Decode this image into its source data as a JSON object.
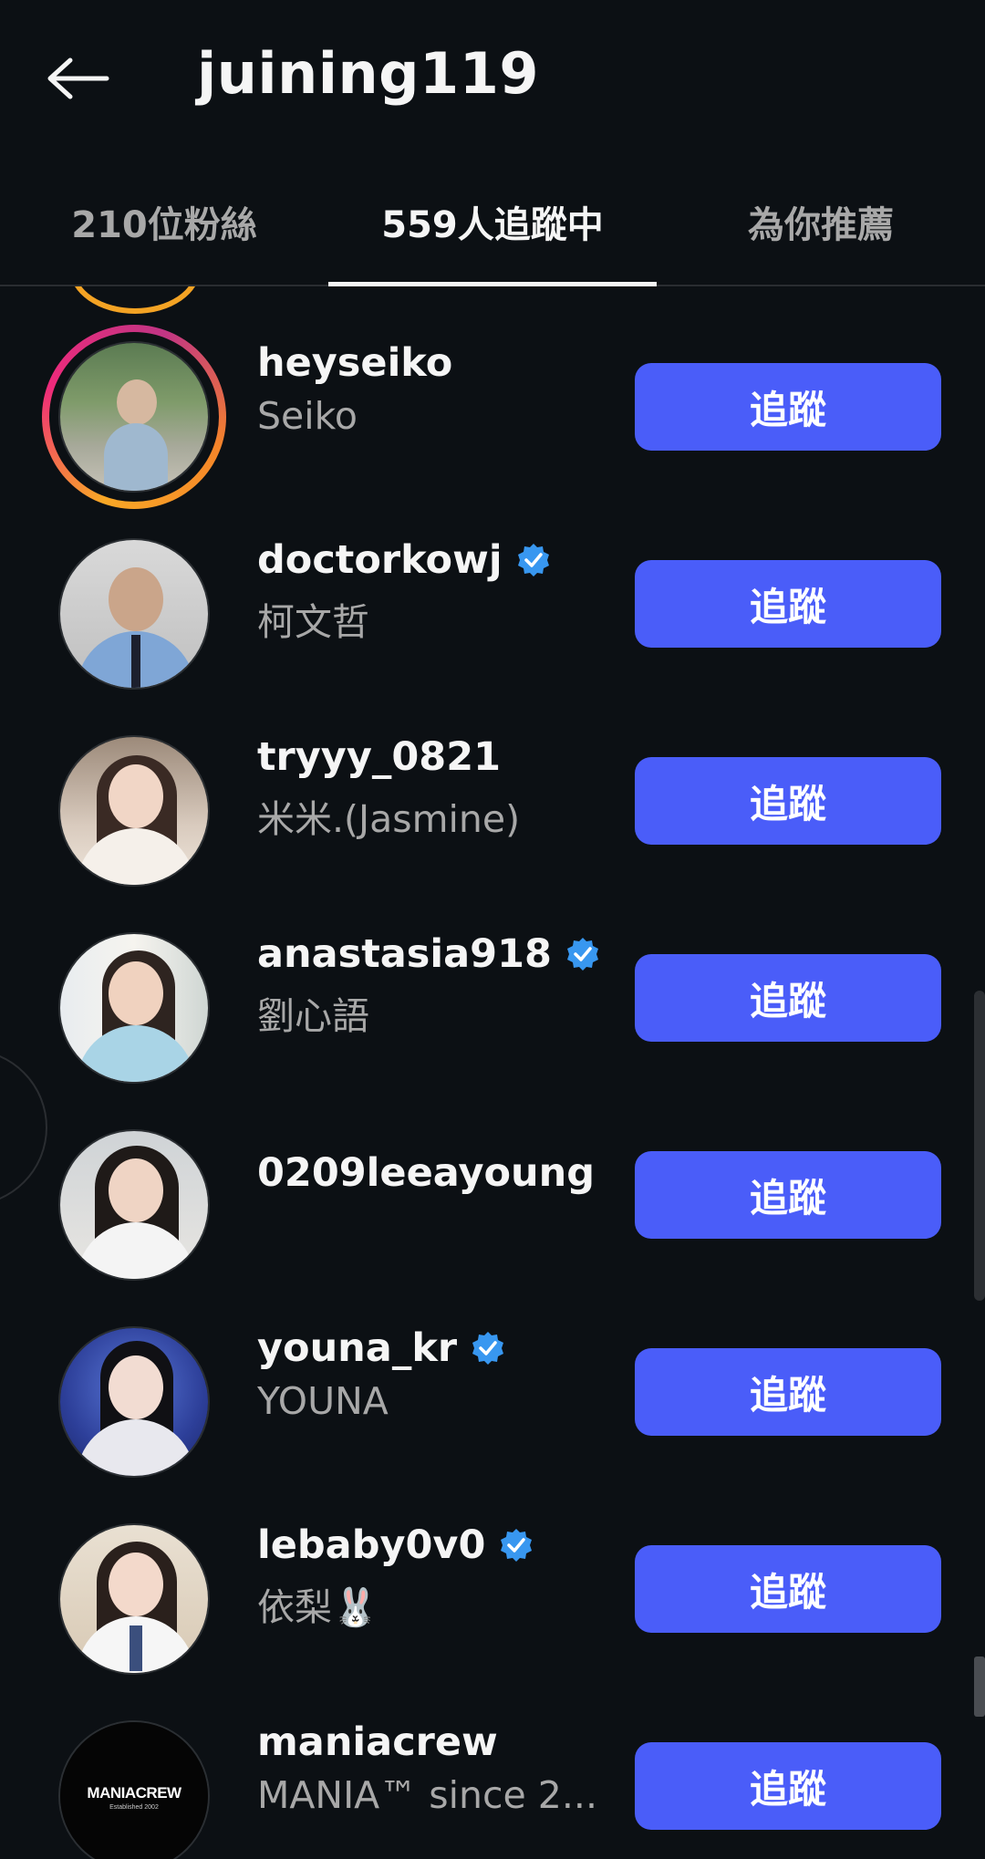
{
  "header": {
    "title": "juining119",
    "back_icon": "arrow-left-icon"
  },
  "tabs": [
    {
      "label": "210位粉絲",
      "active": false
    },
    {
      "label": "559人追蹤中",
      "active": true
    },
    {
      "label": "為你推薦",
      "active": false
    }
  ],
  "follow_label": "追蹤",
  "colors": {
    "background": "#0c1014",
    "button": "#4a5df9",
    "verified": "#3897f0",
    "secondary_text": "#a8a8a8"
  },
  "users": [
    {
      "username": "heyseiko",
      "fullname": "Seiko",
      "verified": false,
      "story_ring": true
    },
    {
      "username": "doctorkowj",
      "fullname": "柯文哲",
      "verified": true,
      "story_ring": false
    },
    {
      "username": "tryyy_0821",
      "fullname": "米米.(Jasmine)",
      "verified": false,
      "story_ring": false
    },
    {
      "username": "anastasia918",
      "fullname": "劉心語",
      "verified": true,
      "story_ring": false
    },
    {
      "username": "0209leeayoung",
      "fullname": "",
      "verified": false,
      "story_ring": false
    },
    {
      "username": "youna_kr",
      "fullname": "YOUNA",
      "verified": true,
      "story_ring": false
    },
    {
      "username": "lebaby0v0",
      "fullname": "依梨🐰",
      "verified": true,
      "story_ring": false
    },
    {
      "username": "maniacrew",
      "fullname": "MANIA™ since 2...",
      "verified": false,
      "story_ring": false,
      "avatar_text": "MANIACREW",
      "avatar_subtext": "Established 2002"
    }
  ]
}
